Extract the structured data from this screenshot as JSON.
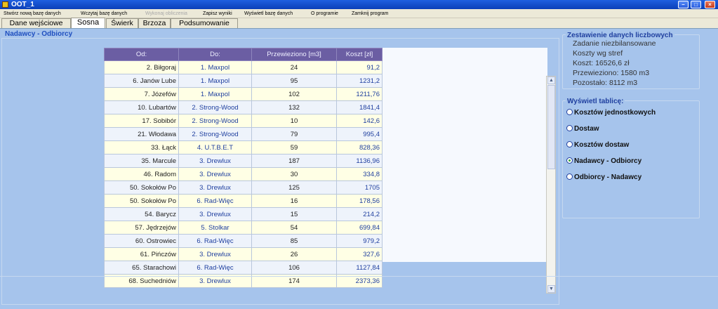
{
  "window": {
    "title": "OOT_1"
  },
  "menu": {
    "items": [
      {
        "label": "Stwórz nową bazę danych",
        "disabled": false
      },
      {
        "label": "Wczytaj bazę danych",
        "disabled": false
      },
      {
        "label": "Wykonaj obliczenia",
        "disabled": true
      },
      {
        "label": "Zapisz wyniki",
        "disabled": false
      },
      {
        "label": "Wyświetl bazę danych",
        "disabled": false
      },
      {
        "label": "O programie",
        "disabled": false
      },
      {
        "label": "Zamknij program",
        "disabled": false
      }
    ]
  },
  "tabs": [
    {
      "label": "Dane wejściowe"
    },
    {
      "label": "Sosna",
      "active": true
    },
    {
      "label": "Świerk"
    },
    {
      "label": "Brzoza"
    },
    {
      "label": "Podsumowanie"
    }
  ],
  "main": {
    "title": "Nadawcy - Odbiorcy"
  },
  "table": {
    "headers": [
      "Od:",
      "Do:",
      "Przewieziono [m3]",
      "Koszt [zł]"
    ],
    "rows": [
      [
        "2. Biłgoraj",
        "1. Maxpol",
        "24",
        "91,2"
      ],
      [
        "6. Janów Lube",
        "1. Maxpol",
        "95",
        "1231,2"
      ],
      [
        "7. Józefów",
        "1. Maxpol",
        "102",
        "1211,76"
      ],
      [
        "10. Lubartów",
        "2. Strong-Wood",
        "132",
        "1841,4"
      ],
      [
        "17. Sobibór",
        "2. Strong-Wood",
        "10",
        "142,6"
      ],
      [
        "21. Włodawa",
        "2. Strong-Wood",
        "79",
        "995,4"
      ],
      [
        "33. Łąck",
        "4. U.T.B.E.T",
        "59",
        "828,36"
      ],
      [
        "35. Marcule",
        "3. Drewlux",
        "187",
        "1136,96"
      ],
      [
        "46. Radom",
        "3. Drewlux",
        "30",
        "334,8"
      ],
      [
        "50. Sokołów Po",
        "3. Drewlux",
        "125",
        "1705"
      ],
      [
        "50. Sokołów Po",
        "6. Rad-Więc",
        "16",
        "178,56"
      ],
      [
        "54. Barycz",
        "3. Drewlux",
        "15",
        "214,2"
      ],
      [
        "57. Jędrzejów",
        "5. Stolkar",
        "54",
        "699,84"
      ],
      [
        "60. Ostrowiec",
        "6. Rad-Więc",
        "85",
        "979,2"
      ],
      [
        "61. Pińczów",
        "3. Drewlux",
        "26",
        "327,6"
      ],
      [
        "65. Starachowi",
        "6. Rad-Więc",
        "106",
        "1127,84"
      ],
      [
        "68. Suchedniów",
        "3. Drewlux",
        "174",
        "2373,36"
      ]
    ]
  },
  "summary": {
    "title": "Zestawienie danych liczbowych",
    "lines": [
      "Zadanie niezbilansowane",
      "Koszty wg stref",
      "Koszt:  16526,6 zł",
      "Przewieziono:  1580 m3",
      "Pozostało:  8112 m3"
    ]
  },
  "view": {
    "title": "Wyświetl tablicę:",
    "options": [
      {
        "label": "Kosztów jednostkowych",
        "selected": false
      },
      {
        "label": "Dostaw",
        "selected": false
      },
      {
        "label": "Kosztów dostaw",
        "selected": false
      },
      {
        "label": "Nadawcy - Odbiorcy",
        "selected": true
      },
      {
        "label": "Odbiorcy - Nadawcy",
        "selected": false
      }
    ]
  }
}
